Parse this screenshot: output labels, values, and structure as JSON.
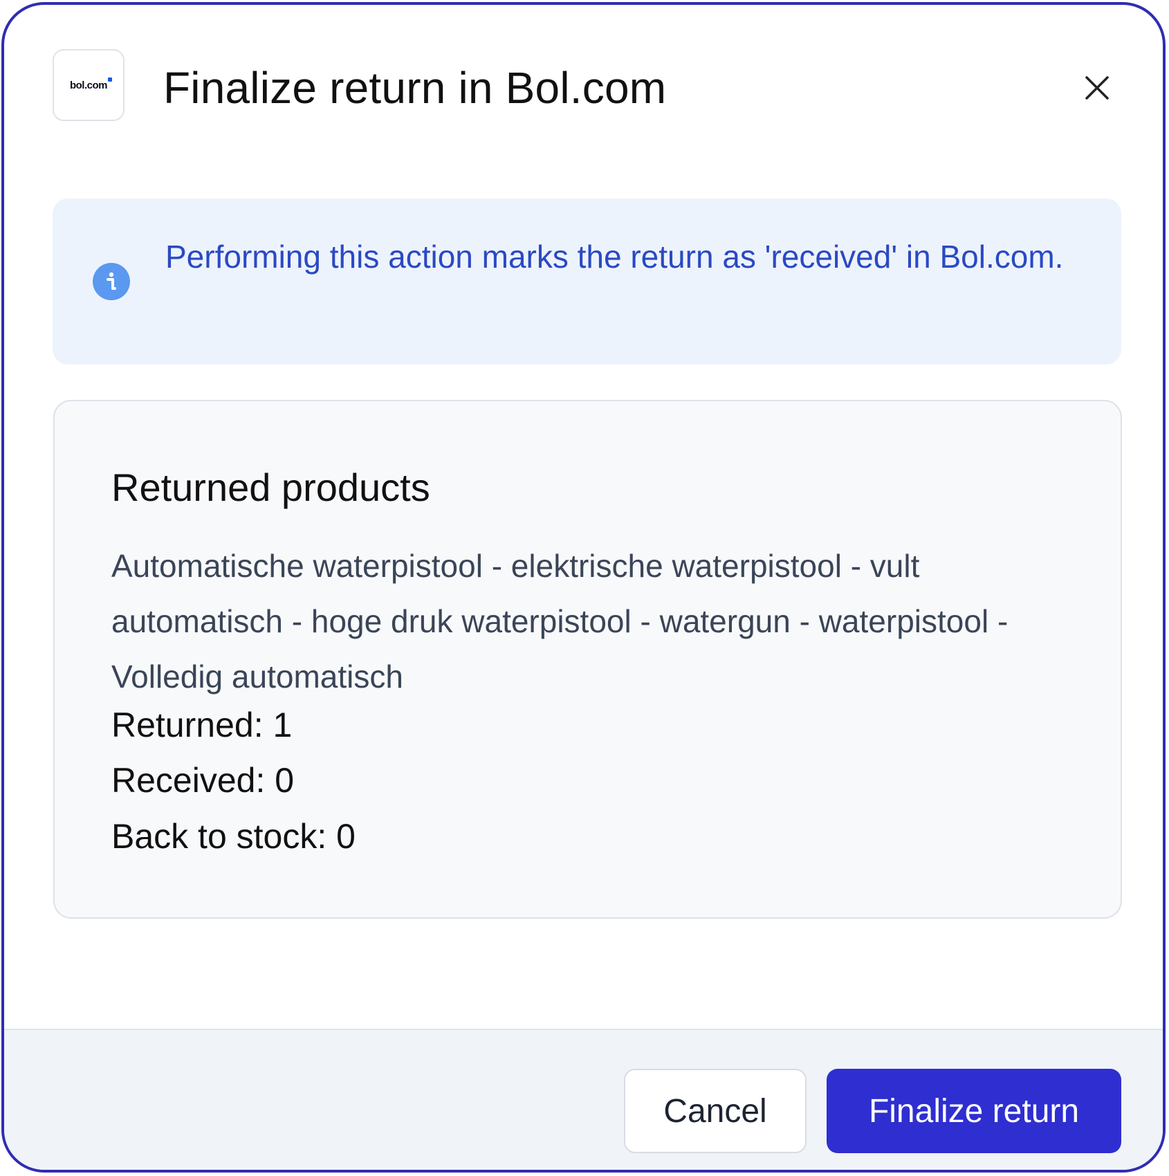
{
  "dialog": {
    "logo_text": "bol.com",
    "title": "Finalize return in Bol.com",
    "close_icon": "close-icon"
  },
  "info": {
    "icon": "info-icon",
    "message": "Performing this action marks the return as 'received' in Bol.com."
  },
  "products": {
    "heading": "Returned products",
    "items": [
      {
        "name": "Automatische waterpistool - elektrische waterpistool - vult automatisch - hoge druk waterpistool - watergun - waterpistool - Volledig automatisch",
        "returned": "Returned: 1",
        "received": "Received: 0",
        "back_to_stock": "Back to stock: 0"
      }
    ]
  },
  "footer": {
    "cancel_label": "Cancel",
    "finalize_label": "Finalize return"
  },
  "colors": {
    "border": "#2f2db3",
    "primary_button": "#2f2ed1",
    "info_bg": "#edf3fc",
    "info_text": "#2a49c3",
    "info_icon": "#5b98f0"
  }
}
